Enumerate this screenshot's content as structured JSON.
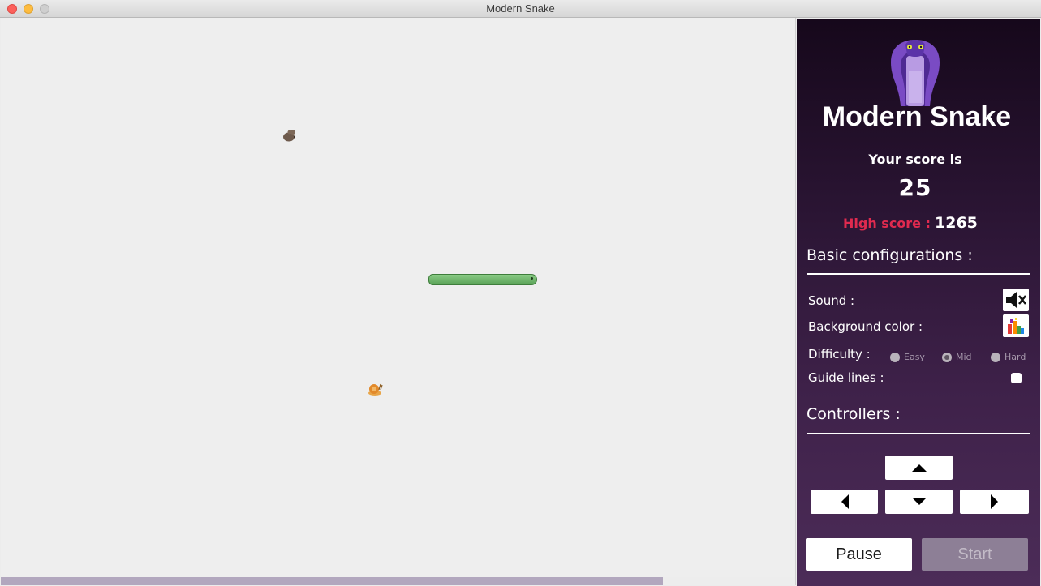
{
  "window": {
    "title": "Modern Snake"
  },
  "board": {
    "background": "#eeeeee",
    "progress_fraction": 0.834,
    "items": [
      {
        "kind": "mouse",
        "icon": "mouse-icon"
      },
      {
        "kind": "snail",
        "icon": "snail-icon"
      }
    ],
    "snake_color": "#6bb768"
  },
  "panel": {
    "title": "Modern Snake",
    "score_label": "Your score is",
    "score": "25",
    "high_score_label": "High score :",
    "high_score": "1265",
    "basic_config_title": "Basic configurations :",
    "sound_label": "Sound :",
    "sound_icon": "speaker-muted-icon",
    "bg_color_label": "Background color :",
    "bg_color_icon": "color-palette-icon",
    "difficulty_label": "Difficulty :",
    "difficulty_options": [
      "Easy",
      "Mid",
      "Hard"
    ],
    "difficulty_selected": "Mid",
    "guide_lines_label": "Guide lines :",
    "guide_lines_checked": false,
    "controllers_title": "Controllers :",
    "pause_label": "Pause",
    "start_label": "Start",
    "accent_color": "#e02a4f"
  }
}
